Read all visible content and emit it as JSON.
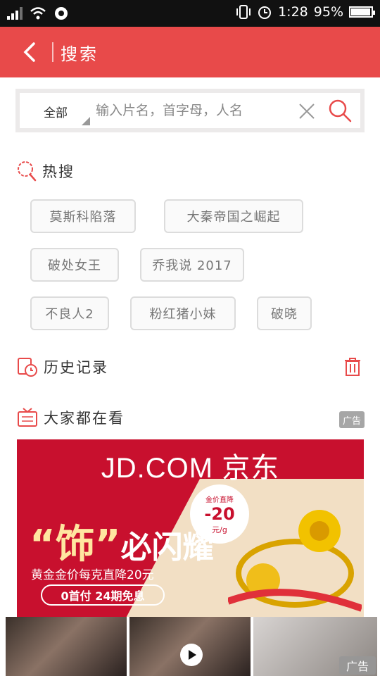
{
  "status_bar": {
    "time": "1:28",
    "battery": "95%",
    "battery_level": 0.95
  },
  "app_bar": {
    "title": "搜索"
  },
  "search": {
    "scope": "全部",
    "placeholder": "输入片名，首字母，人名"
  },
  "hot_search": {
    "title": "热搜",
    "tags": [
      "莫斯科陷落",
      "大秦帝国之崛起",
      "破处女王",
      "乔我说 2017",
      "不良人2",
      "粉红猪小妹",
      "破晓"
    ]
  },
  "history": {
    "title": "历史记录"
  },
  "watching": {
    "title": "大家都在看",
    "ad_label": "广告"
  },
  "banner": {
    "brand": "JD.COM 京东",
    "slogan_big": "“饰”",
    "slogan_rest": "必闪耀",
    "subtitle": "黄金金价每克直降20元",
    "pill": "0首付 24期免息",
    "price_top": "金价直降",
    "price_value": "-20",
    "price_unit": "元/g"
  },
  "bottom_ad": {
    "ad_label": "广告"
  },
  "colors": {
    "accent": "#e84a4a",
    "tag_border": "#dcdcdc",
    "banner_red": "#c8102e"
  }
}
